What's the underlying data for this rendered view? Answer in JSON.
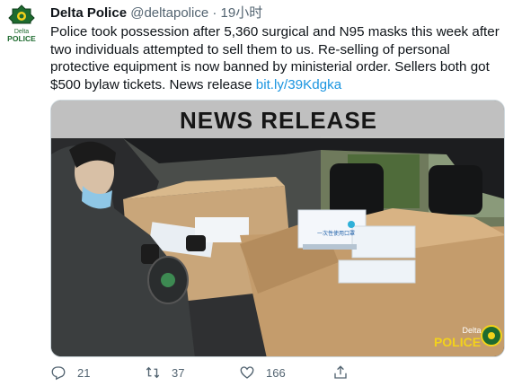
{
  "tweet": {
    "display_name": "Delta Police",
    "handle": "@deltapolice",
    "separator": "·",
    "time": "19小时",
    "text": "Police took possession after 5,360 surgical and N95 masks this week after two individuals attempted to sell them to us. Re-selling of personal protective equipment is now banned by ministerial order. Sellers both got $500 bylaw tickets.  News release ",
    "link": "bit.ly/39Kdgka"
  },
  "avatar": {
    "label_top": "Delta",
    "label_bottom": "POLICE"
  },
  "media": {
    "banner": "NEWS RELEASE",
    "box_text": "一次性使用口罩",
    "watermark_top": "Delta",
    "watermark_bottom": "POLICE"
  },
  "actions": {
    "reply_count": "21",
    "retweet_count": "37",
    "like_count": "166"
  },
  "colors": {
    "link": "#1b95e0",
    "police_green": "#1e6b2f",
    "police_yellow": "#f3d21b",
    "muted": "#536471"
  },
  "icons": [
    "police-badge-icon",
    "reply-icon",
    "retweet-icon",
    "like-icon",
    "share-icon"
  ]
}
